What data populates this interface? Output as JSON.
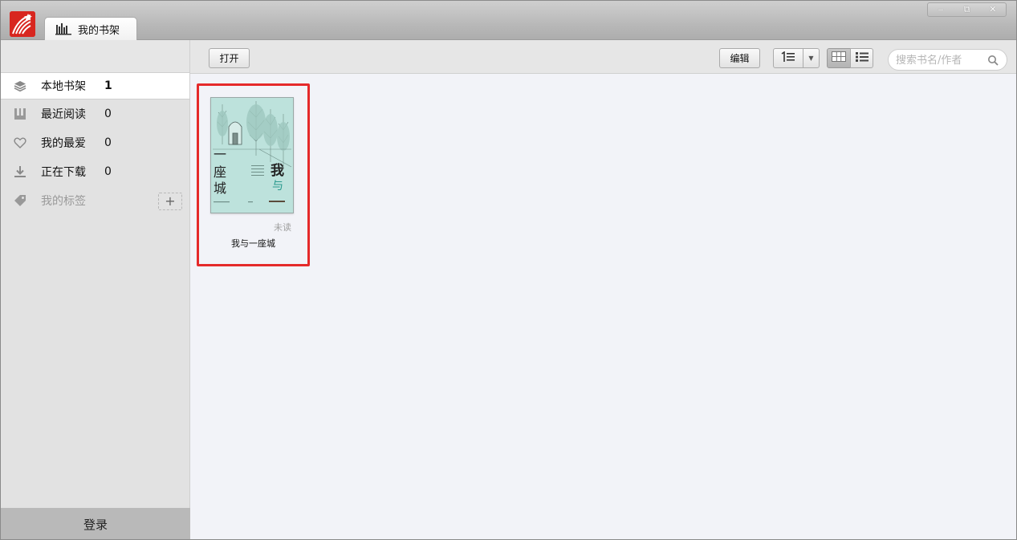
{
  "app": {
    "tab_label": "我的书架"
  },
  "window_controls": {
    "minimize": "‒",
    "restore": "⧉",
    "close": "✕"
  },
  "sidebar": {
    "items": [
      {
        "label": "本地书架",
        "count": "1",
        "icon": "layers-icon"
      },
      {
        "label": "最近阅读",
        "count": "0",
        "icon": "book-icon"
      },
      {
        "label": "我的最爱",
        "count": "0",
        "icon": "heart-icon"
      },
      {
        "label": "正在下载",
        "count": "0",
        "icon": "download-icon"
      },
      {
        "label": "我的标签",
        "count": "",
        "icon": "tag-icon"
      }
    ],
    "add_tag_label": "+",
    "login_label": "登录"
  },
  "toolbar": {
    "open_label": "打开",
    "edit_label": "编辑",
    "sort_dropdown_glyph": "▼",
    "search_placeholder": "搜索书名/作者"
  },
  "books": [
    {
      "title": "我与一座城",
      "status": "未读",
      "cover_text_left": "一座城",
      "cover_text_right_1": "我",
      "cover_text_right_2": "与"
    }
  ],
  "colors": {
    "accent_red": "#e52a2a",
    "logo_red": "#d8261f",
    "cover_teal": "#bfe3de"
  }
}
